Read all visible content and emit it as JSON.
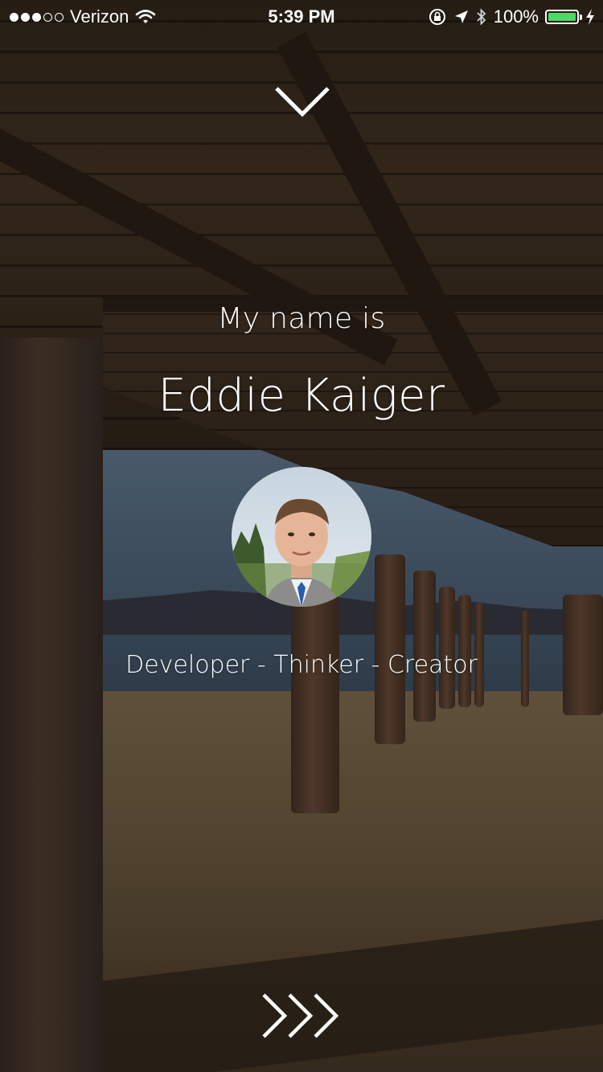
{
  "status_bar": {
    "carrier": "Verizon",
    "time": "5:39 PM",
    "battery_text": "100%",
    "battery_level": 1.0,
    "signal_bars_filled": 3,
    "signal_bars_total": 5,
    "icons": [
      "wifi-icon",
      "orientation-lock-icon",
      "location-arrow-icon",
      "bluetooth-icon",
      "battery-icon",
      "charging-bolt-icon"
    ]
  },
  "header": {
    "collapse_icon": "chevron-down-icon"
  },
  "profile": {
    "intro": "My name is",
    "name": "Eddie Kaiger",
    "tagline": "Developer - Thinker - Creator"
  },
  "footer": {
    "next_icon": "triple-chevron-right-icon"
  },
  "colors": {
    "text": "#ffffff",
    "battery_green": "#4cd964"
  }
}
